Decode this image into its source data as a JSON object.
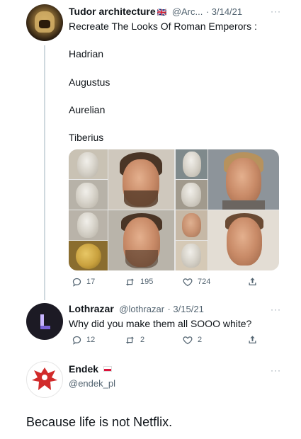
{
  "tweet1": {
    "author_name": "Tudor architecture",
    "flag": "🇬🇧",
    "handle": "@Arc...",
    "date": "· 3/14/21",
    "more": "···",
    "text": "Recreate The Looks Of Roman Emperors :",
    "list": [
      "Hadrian",
      "Augustus",
      "Aurelian",
      "Tiberius"
    ],
    "replies": "17",
    "retweets": "195",
    "likes": "724"
  },
  "tweet2": {
    "author_name": "Lothrazar",
    "handle": "@lothrazar",
    "date": "· 3/15/21",
    "more": "···",
    "text": "Why did you make them all SOOO white?",
    "replies": "12",
    "retweets": "2",
    "likes": "2"
  },
  "tweet3": {
    "author_name": "Endek",
    "handle": "@endek_pl",
    "more": "···",
    "text": "Because life is not Netflix."
  },
  "icons": {
    "reply": "reply-icon",
    "retweet": "retweet-icon",
    "like": "heart-icon",
    "share": "share-icon"
  },
  "colors": {
    "text": "#0f1419",
    "secondary": "#536471",
    "thread_line": "#cfd9de"
  }
}
